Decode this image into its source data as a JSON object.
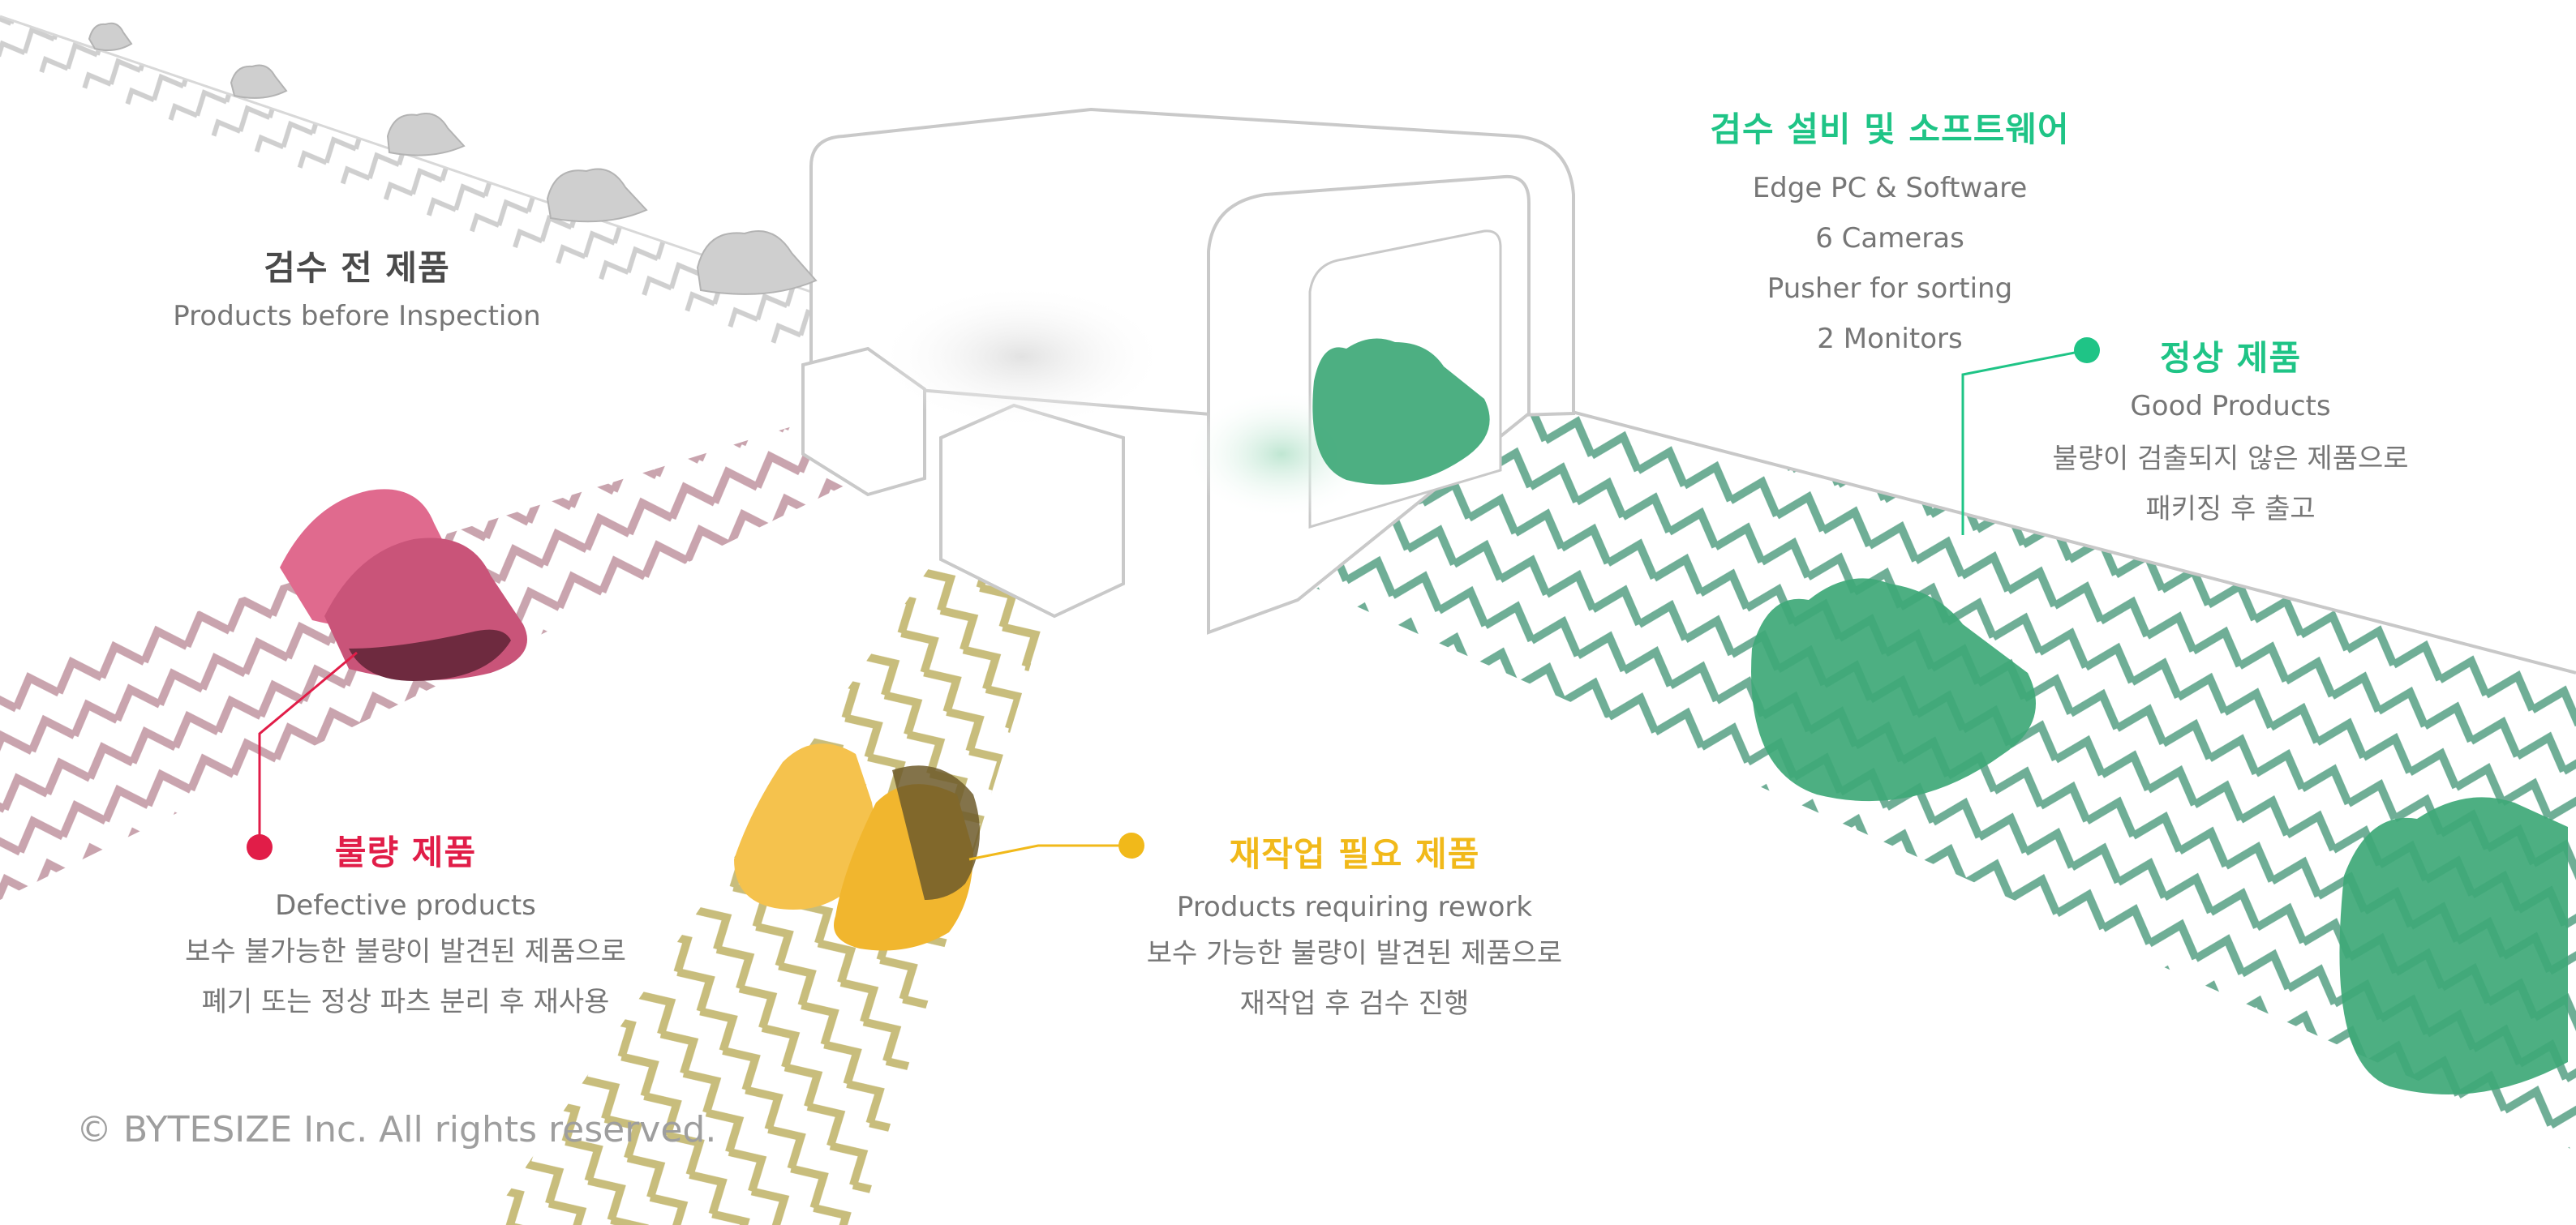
{
  "before": {
    "title": "검수 전 제품",
    "sub": "Products before Inspection"
  },
  "equipment": {
    "title": "검수 설비 및 소프트웨어",
    "items": [
      "Edge PC & Software",
      "6 Cameras",
      "Pusher for sorting",
      "2 Monitors"
    ]
  },
  "good": {
    "title": "정상 제품",
    "sub": "Good Products",
    "desc": [
      "불량이 검출되지 않은 제품으로",
      "패키징 후 출고"
    ]
  },
  "defective": {
    "title": "불량 제품",
    "sub": "Defective products",
    "desc": [
      "보수 불가능한 불량이 발견된 제품으로",
      "폐기 또는 정상 파츠 분리 후 재사용"
    ]
  },
  "rework": {
    "title": "재작업 필요 제품",
    "sub": "Products requiring rework",
    "desc": [
      "보수 가능한 불량이 발견된 제품으로",
      "재작업 후 검수 진행"
    ]
  },
  "copyright": "© BYTESIZE Inc. All rights reserved.",
  "colors": {
    "green": "#1fc486",
    "red": "#e11d48",
    "yellow": "#f1b91a",
    "gray_text": "#767676",
    "title_gray": "#4a4a4a"
  }
}
